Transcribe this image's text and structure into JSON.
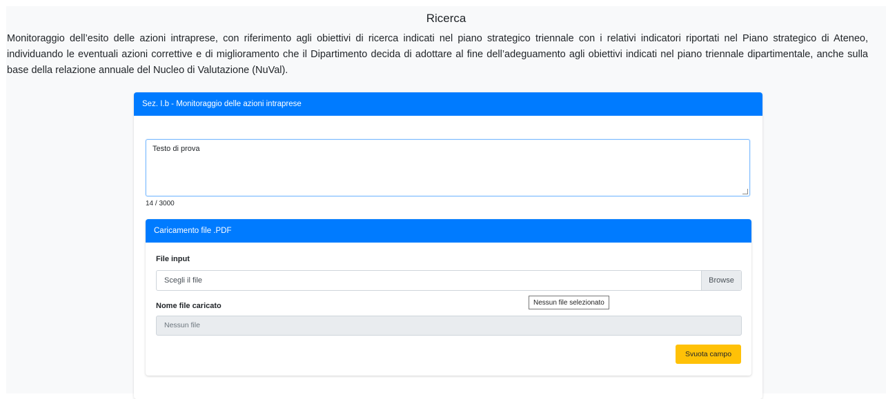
{
  "page": {
    "title": "Ricerca",
    "description": "Monitoraggio dell’esito delle azioni intraprese, con riferimento agli obiettivi di ricerca indicati nel piano strategico triennale con i relativi indicatori riportati nel Piano strategico di Ateneo, individuando le eventuali azioni correttive e di miglioramento che il Dipartimento decida di adottare al fine dell’adeguamento agli obiettivi indicati nel piano triennale dipartimentale, anche sulla base della relazione annuale del Nucleo di Valutazione (NuVal)."
  },
  "section": {
    "header": "Sez. I.b - Monitoraggio delle azioni intraprese",
    "textarea_value": "Testo di prova",
    "char_count": "14 / 3000"
  },
  "upload": {
    "header": "Caricamento file .PDF",
    "file_input_label": "File input",
    "file_input_placeholder": "Scegli il file",
    "browse_label": "Browse",
    "tooltip": "Nessun file selezionato",
    "uploaded_label": "Nome file caricato",
    "uploaded_value": "Nessun file",
    "clear_button": "Svuota campo"
  },
  "colors": {
    "primary": "#007bff",
    "warning": "#ffc107",
    "background": "#f8f9fa"
  }
}
